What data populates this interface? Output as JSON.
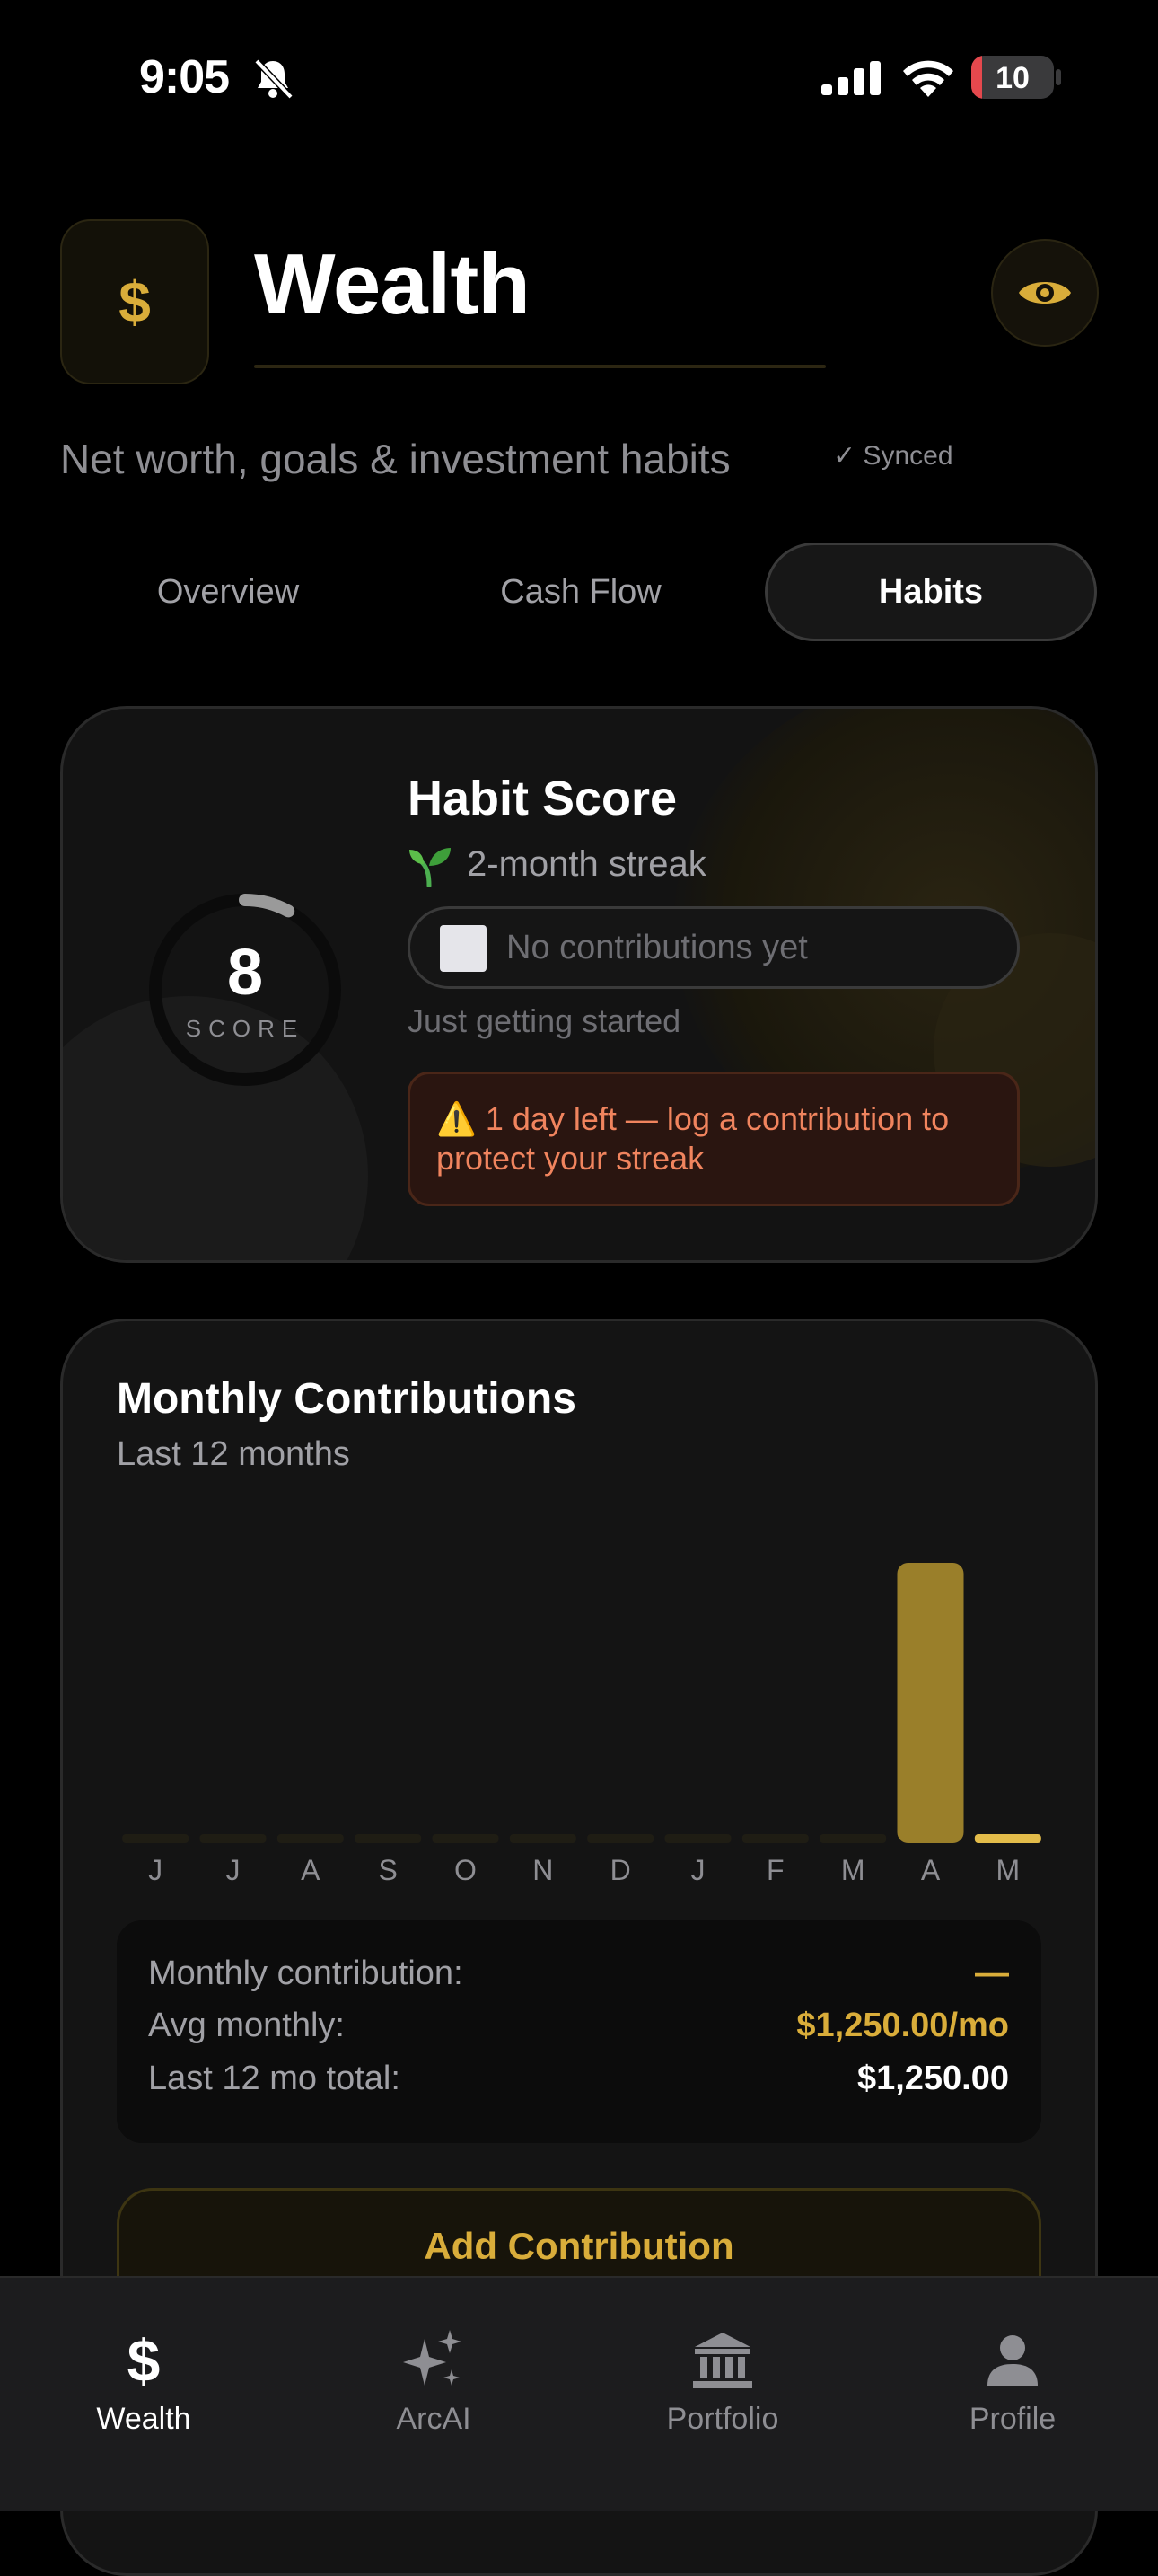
{
  "status": {
    "time": "9:05",
    "battery": "10"
  },
  "header": {
    "logo_glyph": "$",
    "title": "Wealth",
    "subtitle": "Net worth, goals & investment habits",
    "synced": "✓ Synced"
  },
  "tabs": [
    {
      "label": "Overview",
      "active": false
    },
    {
      "label": "Cash Flow",
      "active": false
    },
    {
      "label": "Habits",
      "active": true
    }
  ],
  "habit": {
    "title": "Habit Score",
    "score": "8",
    "score_label": "SCORE",
    "score_fraction": 0.08,
    "streak": "2-month streak",
    "contributions_status": "No contributions yet",
    "note": "Just getting started",
    "warning": "⚠️ 1 day left — log a contribution to protect your streak"
  },
  "monthly": {
    "title": "Monthly Contributions",
    "subtitle": "Last 12 months",
    "summary": [
      {
        "label": "Monthly contribution:",
        "value": "—",
        "color": "#d9ad3a"
      },
      {
        "label": "Avg monthly:",
        "value": "$1,250.00/mo",
        "color": "#d9ad3a"
      },
      {
        "label": "Last 12 mo total:",
        "value": "$1,250.00",
        "color": "#ffffff"
      }
    ],
    "add_button": "Add Contribution"
  },
  "chart_data": {
    "type": "bar",
    "categories": [
      "J",
      "J",
      "A",
      "S",
      "O",
      "N",
      "D",
      "J",
      "F",
      "M",
      "A",
      "M"
    ],
    "values": [
      0,
      0,
      0,
      0,
      0,
      0,
      0,
      0,
      0,
      0,
      1250,
      0
    ],
    "highlight_index": 11,
    "ylim": [
      0,
      1250
    ],
    "bar_color": "#9a7f2a",
    "highlight_color": "#e3bc4a",
    "empty_color": "#1f1d14"
  },
  "nav": [
    {
      "label": "Wealth",
      "icon": "dollar-icon",
      "active": true
    },
    {
      "label": "ArcAI",
      "icon": "sparkles-icon",
      "active": false
    },
    {
      "label": "Portfolio",
      "icon": "bank-icon",
      "active": false
    },
    {
      "label": "Profile",
      "icon": "person-icon",
      "active": false
    }
  ],
  "colors": {
    "accent": "#d9ad3a",
    "warning": "#f0845e"
  }
}
